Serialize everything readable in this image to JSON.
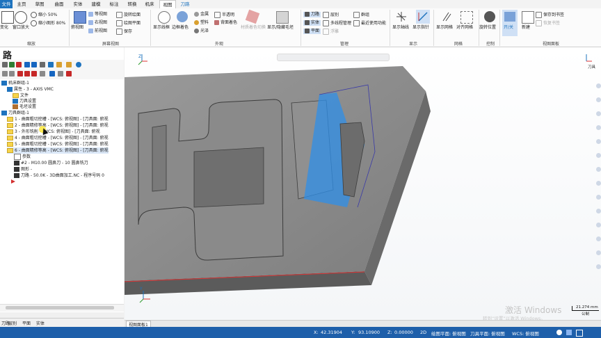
{
  "menu": {
    "tabs": [
      "文件",
      "主页",
      "草图",
      "曲面",
      "实体",
      "建模",
      "标注",
      "转换",
      "机床",
      "视图",
      "刀路"
    ],
    "active": "视图",
    "contextual": "刀路"
  },
  "ribbon": {
    "groups": {
      "zoom": {
        "label": "缩放",
        "window_zoom": "窗口放大",
        "shrink50": "缩小 50%",
        "shrink80": "缩小图形 80%",
        "fit_prefix": "变化"
      },
      "view": {
        "label": "屏幕视图",
        "top": "俯视图",
        "iso": "等视图",
        "right": "右视图",
        "front": "前视图",
        "rotate_plane": "旋转绘面",
        "draw_plane": "绘图平面",
        "save": "保存"
      },
      "appearance": {
        "label": "外观",
        "wireframe": "显示线框",
        "edge_color": "边框着色",
        "metal": "金属",
        "plastic": "塑料",
        "glossy": "光泽",
        "translucent": "半透明",
        "back_color": "背面着色",
        "mat_color": "材质着色切换",
        "show_hide_blank": "显示/隐藏毛坯"
      },
      "manage": {
        "label": "管理",
        "toolpath": "刀路",
        "layer": "层别",
        "solid": "实体",
        "multi": "多线程管理",
        "plane": "平面",
        "float": "浮雕",
        "group": "群组",
        "recent": "最近使用功能"
      },
      "display": {
        "label": "显示",
        "axis": "显示轴线",
        "indicator": "显示指针"
      },
      "grid": {
        "label": "网格",
        "show_grid": "显示网格",
        "snap_grid": "对齐网格"
      },
      "control": {
        "label": "控制",
        "spin": "旋转位置"
      },
      "viewsheet": {
        "label": "视图面板",
        "toggle": "开/关",
        "new": "新建",
        "save_bookmark": "保存到书签",
        "restore_bookmark": "恢复书签"
      }
    }
  },
  "left_panel": {
    "title": "路",
    "tree": [
      {
        "text": "机床群组-1",
        "level": 0,
        "icon": "machine-group-icon"
      },
      {
        "text": "属性 - 3 - AXIS VMC",
        "level": 1,
        "icon": "properties-icon"
      },
      {
        "text": "文件",
        "level": 2,
        "icon": "file-icon"
      },
      {
        "text": "刀具设置",
        "level": 2,
        "icon": "tool-settings-icon"
      },
      {
        "text": "毛坯设置",
        "level": 2,
        "icon": "stock-settings-icon"
      },
      {
        "text": "刀具群组-1",
        "level": 1,
        "icon": "tool-group-icon"
      },
      {
        "text": "1 - 曲面粗切挖槽 - [WCS: 俯视图] - [刀具面: 俯视",
        "level": 2,
        "icon": "folder-icon"
      },
      {
        "text": "2 - 曲面精修等高 - [WCS: 俯视图] - [刀具面: 俯视",
        "level": 2,
        "icon": "folder-icon",
        "highlight": "精修等"
      },
      {
        "text": "3 - 外形铣削 - [WCS: 俯视图] - [刀具面: 俯视",
        "level": 2,
        "icon": "folder-icon"
      },
      {
        "text": "4 - 曲面粗切挖槽 - [WCS: 俯视图] - [刀具面: 俯视",
        "level": 2,
        "icon": "folder-icon"
      },
      {
        "text": "5 - 曲面粗切挖槽 - [WCS: 俯视图] - [刀具面: 俯视",
        "level": 2,
        "icon": "folder-icon"
      },
      {
        "text": "6 - 曲面精修等高 - [WCS: 俯视图] - [刀具面: 俯视",
        "level": 2,
        "icon": "folder-icon",
        "selected": true
      },
      {
        "text": "参数",
        "level": 3,
        "icon": "params-icon"
      },
      {
        "text": "#2 - M10.00 圆鼻刀 - 10 圆鼻铣刀",
        "level": 3,
        "icon": "tool-icon"
      },
      {
        "text": "图形 -",
        "level": 3,
        "icon": "geometry-icon"
      },
      {
        "text": "刀路 - 50.0K - 3D曲面加工.NC - 程序号码 0",
        "level": 3,
        "icon": "nc-icon"
      }
    ],
    "bottom_tabs": [
      "刀路",
      "层别",
      "平面",
      "实体"
    ]
  },
  "viewport": {
    "tab": "视图面板1",
    "watermark_line1": "激活 Windows",
    "watermark_line2": "转到“设置”以激活 Windows。",
    "scale_value": "21.274 mm",
    "scale_unit": "公制",
    "axis_x": "X",
    "axis_y": "Y",
    "axis_z": "Z",
    "corner_label": "刀具"
  },
  "status": {
    "x_label": "X:",
    "x": "42.31904",
    "y_label": "Y:",
    "y": "93.10900",
    "z_label": "Z:",
    "z": "0.00000",
    "mode": "2D",
    "draw_plane": "绘图平面: 俯视图",
    "tool_plane": "刀具平面: 俯视图",
    "wcs": "WCS: 俯视图"
  },
  "colors": {
    "accent": "#1e73be",
    "status_bg": "#1e5faa",
    "viewport_bg": "#ffffff",
    "part_gray": "#8c8c8c",
    "toolpath_blue": "#2f8fe8"
  }
}
